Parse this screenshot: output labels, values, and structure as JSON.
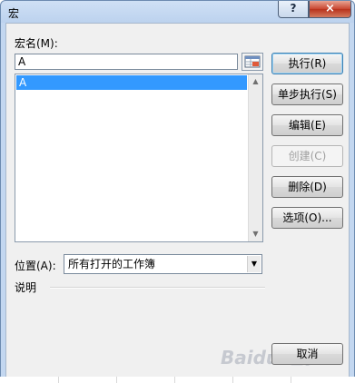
{
  "window": {
    "title": "宏",
    "help": "?",
    "close": "×"
  },
  "macro_name": {
    "label": "宏名(M):",
    "value": "A"
  },
  "macro_list": {
    "items": [
      "A"
    ],
    "selected": "A"
  },
  "buttons": {
    "run": "执行(R)",
    "step_into": "单步执行(S)",
    "edit": "编辑(E)",
    "create": "创建(C)",
    "delete": "删除(D)",
    "options": "选项(O)...",
    "cancel": "取消"
  },
  "location": {
    "label": "位置(A):",
    "value": "所有打开的工作簿"
  },
  "description": {
    "label": "说明"
  },
  "watermark": "Baidu 经验",
  "colors": {
    "selection": "#3399ff",
    "dialog_bg": "#f0f0f0",
    "close_red": "#c8452f"
  }
}
